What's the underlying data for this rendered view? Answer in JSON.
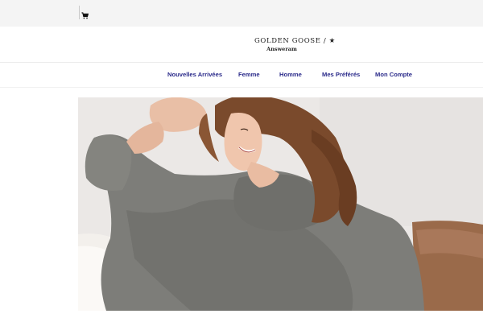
{
  "topbar": {
    "cart_icon": "shopping-cart-icon"
  },
  "logo": {
    "main": "GOLDEN GOOSE / ★",
    "sub": "Answeram"
  },
  "nav": {
    "items": [
      {
        "label": "Nouvelles Arrivées"
      },
      {
        "label": "Femme"
      },
      {
        "label": "Homme"
      },
      {
        "label": "Mes Préférés"
      },
      {
        "label": "Mon Compte"
      }
    ]
  },
  "hero": {
    "image": "woman-in-grey-turtleneck-sweater"
  },
  "colors": {
    "nav_link": "#2a2a8a",
    "topbar_bg": "#f4f4f4"
  }
}
